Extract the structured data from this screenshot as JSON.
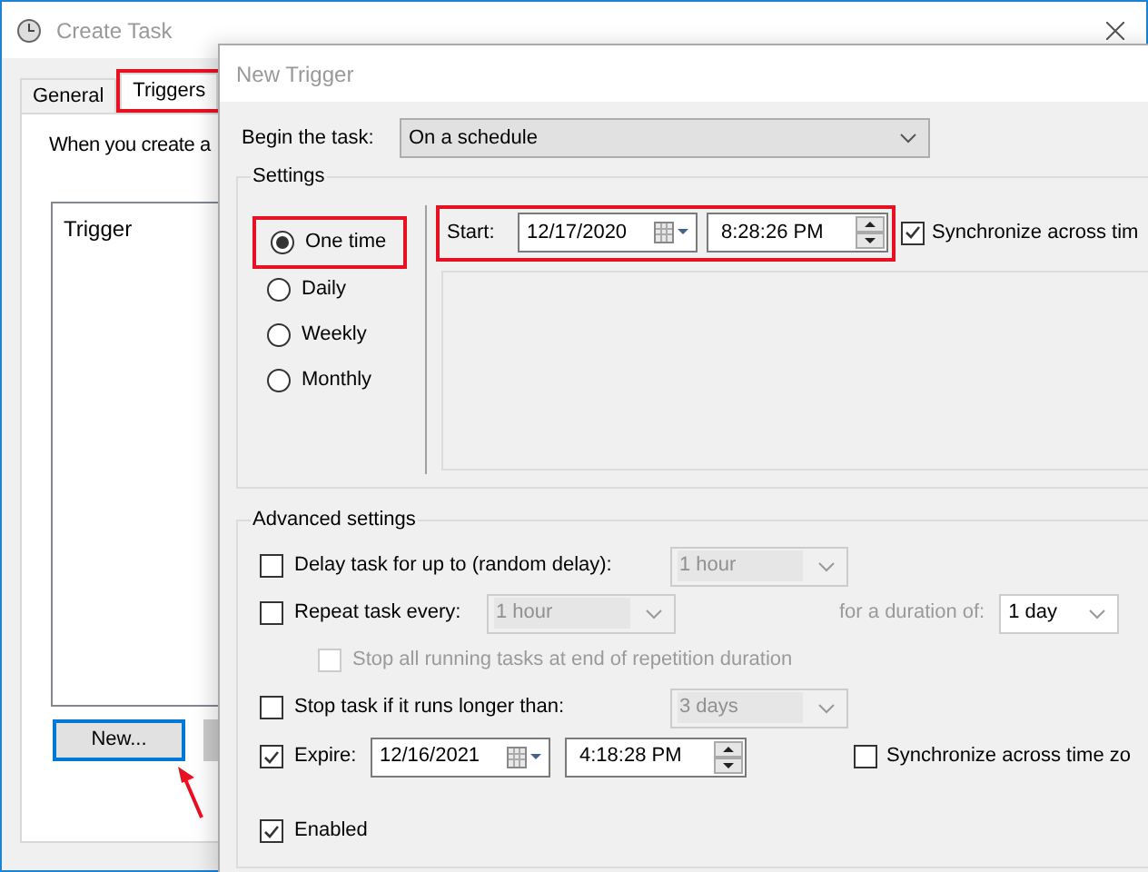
{
  "create_task": {
    "title": "Create Task",
    "tabs": [
      {
        "label": "General",
        "selected": false
      },
      {
        "label": "Triggers",
        "selected": true
      }
    ],
    "description": "When you create a",
    "trigger_list": {
      "column": "Trigger"
    },
    "new_button": "New..."
  },
  "new_trigger": {
    "title": "New Trigger",
    "begin_label": "Begin the task:",
    "begin_value": "On a schedule",
    "settings": {
      "title": "Settings",
      "schedule": [
        {
          "label": "One time",
          "selected": true
        },
        {
          "label": "Daily",
          "selected": false
        },
        {
          "label": "Weekly",
          "selected": false
        },
        {
          "label": "Monthly",
          "selected": false
        }
      ],
      "start_label": "Start:",
      "start_date": "12/17/2020",
      "start_time": "8:28:26 PM",
      "sync": {
        "label": "Synchronize across tim",
        "checked": true
      }
    },
    "advanced": {
      "title": "Advanced settings",
      "delay": {
        "label": "Delay task for up to (random delay):",
        "checked": false,
        "value": "1 hour"
      },
      "repeat": {
        "label": "Repeat task every:",
        "checked": false,
        "value": "1 hour",
        "duration_label": "for a duration of:",
        "duration_value": "1 day"
      },
      "stop_all": {
        "label": "Stop all running tasks at end of repetition duration",
        "checked": false,
        "disabled": true
      },
      "stop_longer": {
        "label": "Stop task if it runs longer than:",
        "checked": false,
        "value": "3 days"
      },
      "expire": {
        "label": "Expire:",
        "checked": true,
        "date": "12/16/2021",
        "time": "4:18:28 PM",
        "sync": {
          "label": "Synchronize across time zo",
          "checked": false
        }
      },
      "enabled": {
        "label": "Enabled",
        "checked": true
      }
    }
  }
}
